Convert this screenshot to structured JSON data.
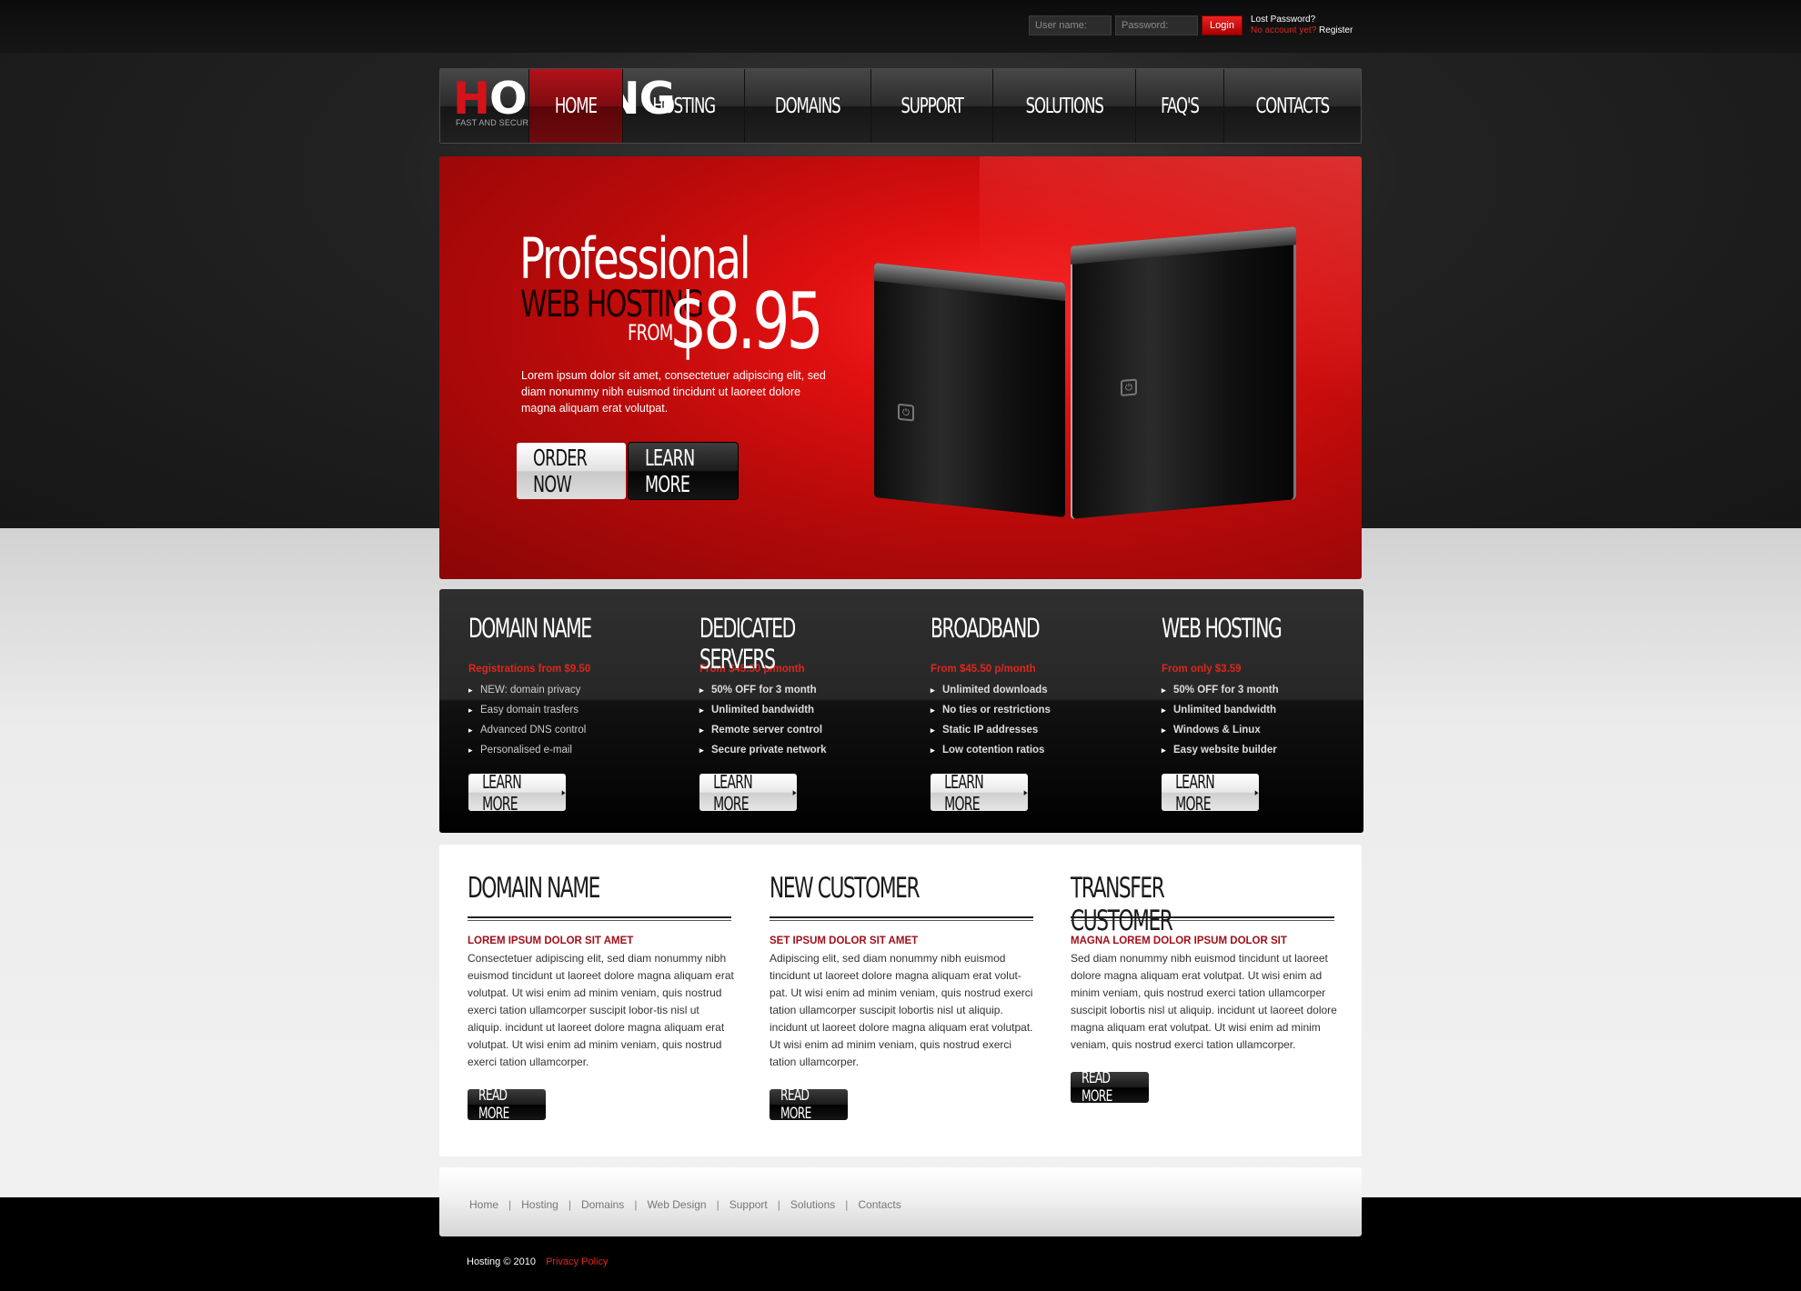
{
  "login": {
    "username_placeholder": "User name:",
    "password_placeholder": "Password:",
    "login_label": "Login",
    "lost_password": "Lost Password?",
    "no_account": "No account yet?",
    "register": "Register"
  },
  "logo": {
    "first_letter": "H",
    "rest": "OSTING",
    "tagline": "FAST AND SECURE SERVERS"
  },
  "nav": [
    "HOME",
    "HOSTING",
    "DOMAINS",
    "SUPPORT",
    "SOLUTIONS",
    "FAQ'S",
    "CONTACTS"
  ],
  "banner": {
    "line1": "Professional",
    "line2": "WEB HOSTING",
    "from": "FROM",
    "price": "$8.95",
    "text": "Lorem ipsum dolor sit amet, consectetuer adipiscing elit, sed diam nonummy nibh euismod tincidunt ut laoreet dolore magna aliquam erat volutpat.",
    "order_label": "ORDER NOW",
    "learn_label": "LEARN MORE"
  },
  "services": [
    {
      "title": "DOMAIN NAME",
      "sub": "Registrations from $9.50",
      "items": [
        "NEW:  domain privacy",
        "Easy domain trasfers",
        "Advanced DNS control",
        "Personalised e-mail"
      ],
      "button": "LEARN MORE"
    },
    {
      "title": "DEDICATED SERVERS",
      "sub": "From $45.50 p/month",
      "items": [
        "50% OFF for 3 month",
        "Unlimited bandwidth",
        "Remote server control",
        "Secure private network"
      ],
      "button": "LEARN MORE"
    },
    {
      "title": "BROADBAND",
      "sub": "From $45.50 p/month",
      "items": [
        "Unlimited downloads",
        "No ties or restrictions",
        "Static IP addresses",
        "Low cotention ratios"
      ],
      "button": "LEARN MORE"
    },
    {
      "title": "WEB HOSTING",
      "sub": "From only $3.59",
      "items": [
        "50% OFF for 3 month",
        "Unlimited bandwidth",
        "Windows & Linux",
        "Easy website builder"
      ],
      "button": "LEARN MORE"
    }
  ],
  "columns": [
    {
      "title": "DOMAIN NAME",
      "sub": "LOREM IPSUM DOLOR SIT AMET",
      "text": "Consectetuer adipiscing elit, sed diam nonummy nibh euismod tincidunt ut laoreet dolore magna aliquam erat volutpat. Ut wisi enim ad minim veniam, quis nostrud exerci tation ullamcorper suscipit lobor-tis nisl ut aliquip. incidunt ut laoreet dolore magna aliquam erat volutpat. Ut wisi enim ad minim veniam, quis nostrud exerci tation ullamcorper.",
      "button": "READ MORE"
    },
    {
      "title": "NEW CUSTOMER",
      "sub": "SET IPSUM DOLOR SIT AMET",
      "text": "Adipiscing elit, sed diam nonummy nibh euismod tincidunt ut laoreet dolore magna aliquam erat volut-pat. Ut wisi enim ad minim veniam, quis nostrud exerci tation ullamcorper suscipit lobortis nisl ut aliquip. incidunt ut laoreet dolore magna aliquam erat volutpat. Ut wisi enim ad minim veniam, quis nostrud exerci tation ullamcorper.",
      "button": "READ MORE"
    },
    {
      "title": "TRANSFER CUSTOMER",
      "sub": "MAGNA LOREM DOLOR IPSUM DOLOR SIT",
      "text": "Sed diam nonummy nibh euismod tincidunt ut laoreet dolore magna aliquam erat volutpat. Ut wisi enim ad minim veniam, quis nostrud exerci tation ullamcorper suscipit lobortis nisl ut aliquip. incidunt ut laoreet dolore magna aliquam erat volutpat. Ut wisi enim ad minim veniam, quis nostrud exerci tation ullamcorper.",
      "button": "READ MORE"
    }
  ],
  "footer_nav": [
    "Home",
    "Hosting",
    "Domains",
    "Web Design",
    "Support",
    "Solutions",
    "Contacts"
  ],
  "footer": {
    "copyright": "Hosting © 2010",
    "privacy": "Privacy Policy"
  },
  "colors": {
    "accent_red": "#d3121a",
    "dark": "#161616"
  }
}
